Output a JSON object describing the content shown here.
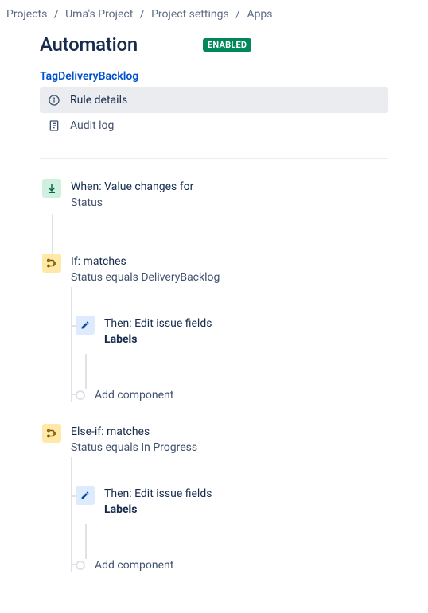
{
  "breadcrumb": {
    "items": [
      "Projects",
      "Uma's Project",
      "Project settings",
      "Apps"
    ]
  },
  "header": {
    "title": "Automation",
    "badge": "ENABLED"
  },
  "rule": {
    "name": "TagDeliveryBacklog",
    "tabs": {
      "rule_details": "Rule details",
      "audit_log": "Audit log"
    }
  },
  "flow": {
    "trigger": {
      "title": "When: Value changes for",
      "sub": "Status"
    },
    "cond1": {
      "title": "If: matches",
      "sub": "Status equals DeliveryBacklog",
      "action": {
        "title": "Then: Edit issue fields",
        "sub": "Labels"
      },
      "add": "Add component"
    },
    "cond2": {
      "title": "Else-if: matches",
      "sub": "Status equals In Progress",
      "action": {
        "title": "Then: Edit issue fields",
        "sub": "Labels"
      },
      "add": "Add component"
    }
  }
}
